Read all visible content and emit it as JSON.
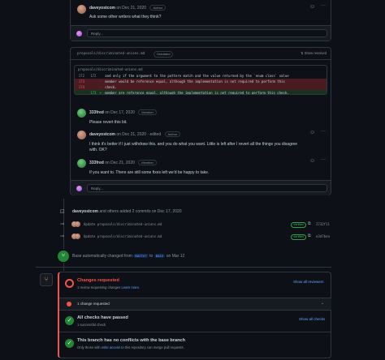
{
  "thread1": {
    "comment": {
      "author": "daveyostcom",
      "date": "on Dec 21, 2020",
      "badge": "Author",
      "body": "Ask some other writers what they think?"
    },
    "reply_placeholder": "Reply..."
  },
  "file_thread": {
    "filename": "proposals/discriminated-unions.md",
    "outdated_badge": "Outdated",
    "show_resolved": "Show resolved",
    "inner_filename": "proposals/discriminated-unions.md",
    "diff": [
      {
        "old": "172",
        "new": "172",
        "sign": " ",
        "text": "and only if the argument to the pattern match and the value returned by the `enum class` value",
        "type": "context"
      },
      {
        "old": "173",
        "new": "",
        "sign": "-",
        "text": "member would be reference equal, although the implementation is not required to perform this",
        "type": "del"
      },
      {
        "old": "174",
        "new": "",
        "sign": "-",
        "text": "check.",
        "type": "del"
      },
      {
        "old": "",
        "new": "173",
        "sign": "+",
        "text": "member are reference equal, although the implementation is not required to perform this check.",
        "type": "add"
      }
    ],
    "comments": [
      {
        "author": "333fred",
        "date": "on Dec 17, 2020",
        "badge": "Member",
        "body": "Please revert this bit."
      },
      {
        "author": "daveyostcom",
        "date": "on Dec 21, 2020 · edited",
        "badge": "Author",
        "body": "I think it's better if I just withdraw this. and you do what you want. Little is left after I revert all the things you disagree with. OK?"
      },
      {
        "author": "333fred",
        "date": "on Dec 21, 2020",
        "badge": "Member",
        "body": "If you want to. There are still some fixes left we'd be happy to take."
      }
    ],
    "reply_placeholder": "Reply..."
  },
  "commits_event": {
    "text_author": "daveyostcom",
    "text_rest": "and others added 2 commits",
    "date": "on Dec 17, 2020",
    "commits": [
      {
        "message": "Update proposals/discriminated-unions.md",
        "verified": "Verified",
        "sha": "2732f11"
      },
      {
        "message": "Update proposals/discriminated-unions.md",
        "verified": "Verified",
        "sha": "e3d7bea"
      }
    ]
  },
  "base_change": {
    "text_pre": "Base automatically changed from",
    "from": "master",
    "to": "to",
    "target": "main",
    "date": "on Mar 12"
  },
  "merge_box": {
    "changes_requested": {
      "title": "Changes requested",
      "subtitle": "1 review requesting changes",
      "learn_more": "Learn more.",
      "show_all": "Show all reviewers"
    },
    "change_requested_row": "1 change requested",
    "checks": {
      "title": "All checks have passed",
      "subtitle": "1 successful check",
      "show_all": "Show all checks"
    },
    "no_conflicts": {
      "title": "This branch has no conflicts with the base branch",
      "subtitle_pre": "Only those with",
      "subtitle_link": "write access",
      "subtitle_post": "to this repository can merge pull requests."
    }
  },
  "colors": {
    "bg": "#0d1117",
    "border": "#30363d",
    "link": "#58a6ff",
    "danger": "#f85149",
    "success": "#238636"
  }
}
